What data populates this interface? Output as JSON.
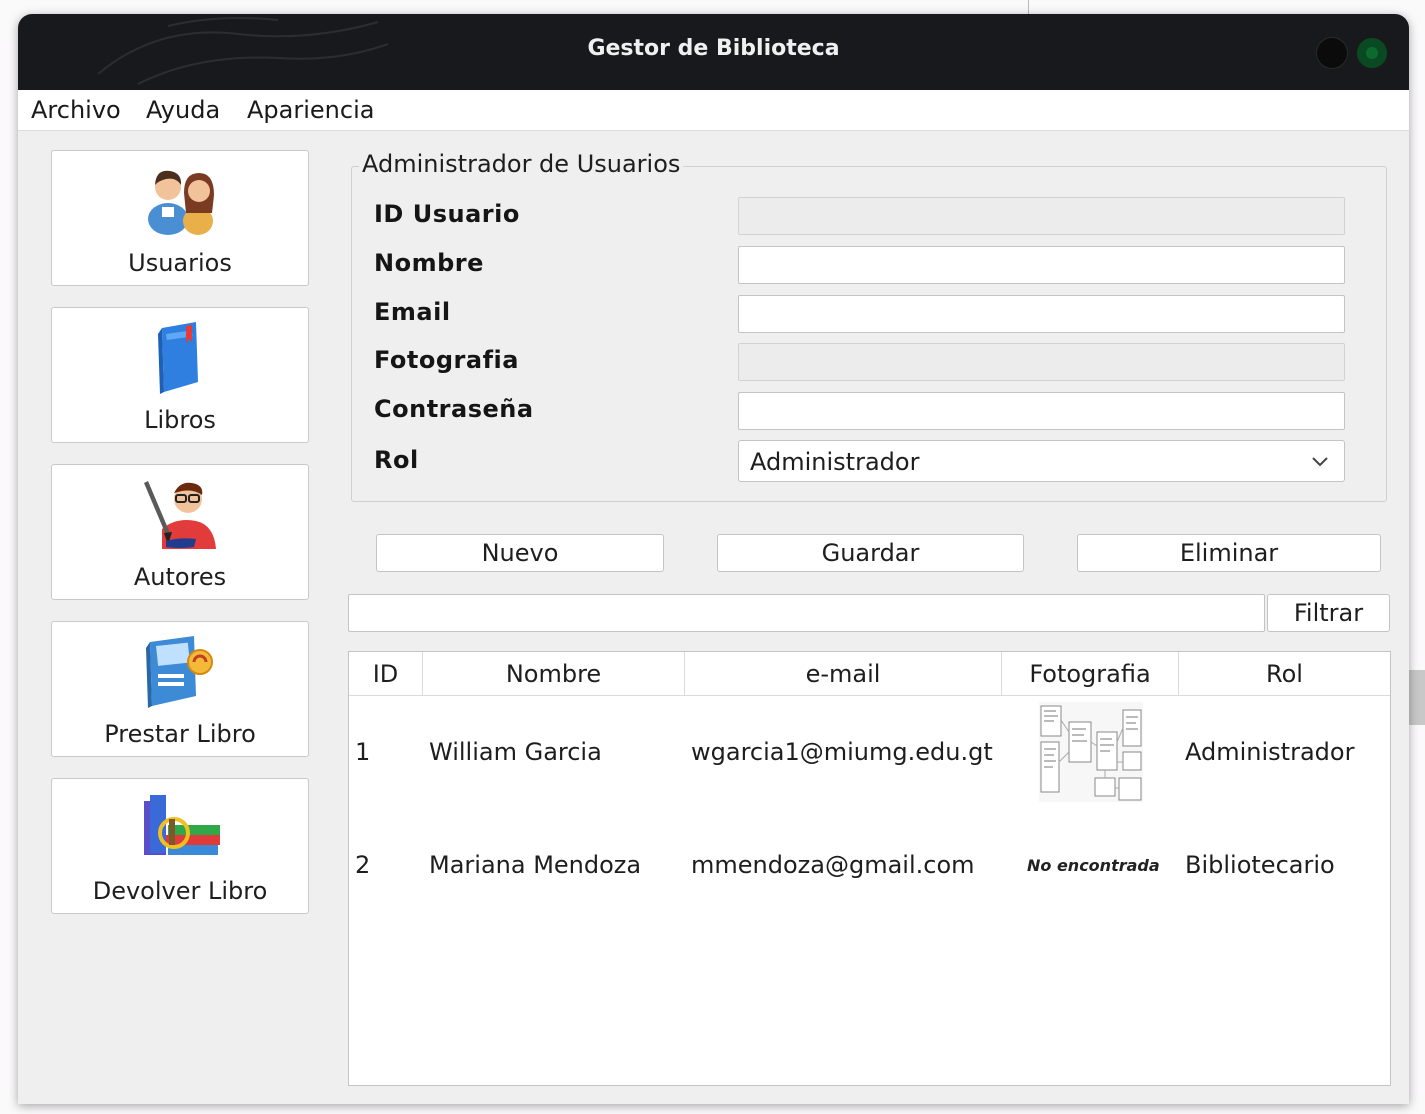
{
  "window": {
    "title": "Gestor de Biblioteca"
  },
  "menu": [
    "Archivo",
    "Ayuda",
    "Apariencia"
  ],
  "sidebar": {
    "items": [
      {
        "label": "Usuarios",
        "icon": "users-icon"
      },
      {
        "label": "Libros",
        "icon": "book-icon"
      },
      {
        "label": "Autores",
        "icon": "author-icon"
      },
      {
        "label": "Prestar Libro",
        "icon": "lend-book-icon"
      },
      {
        "label": "Devolver Libro",
        "icon": "return-book-icon"
      }
    ]
  },
  "form": {
    "group_title": "Administrador de Usuarios",
    "labels": {
      "id": "ID Usuario",
      "nombre": "Nombre",
      "email": "Email",
      "fotografia": "Fotografia",
      "contrasena": "Contraseña",
      "rol": "Rol"
    },
    "values": {
      "id": "",
      "nombre": "",
      "email": "",
      "fotografia": "",
      "contrasena": ""
    },
    "rol_selected": "Administrador"
  },
  "actions": {
    "nuevo": "Nuevo",
    "guardar": "Guardar",
    "eliminar": "Eliminar"
  },
  "filter": {
    "value": "",
    "button": "Filtrar"
  },
  "table": {
    "columns": [
      "ID",
      "Nombre",
      "e-mail",
      "Fotografia",
      "Rol"
    ],
    "rows": [
      {
        "id": "1",
        "nombre": "William Garcia",
        "email": "wgarcia1@miumg.edu.gt",
        "foto": "",
        "rol": "Administrador"
      },
      {
        "id": "2",
        "nombre": "Mariana Mendoza",
        "email": "mmendoza@gmail.com",
        "foto": "No encontrada",
        "rol": "Bibliotecario"
      }
    ]
  },
  "colors": {
    "titlebar": "#17191d",
    "window_bg": "#efefef",
    "close_button": "#0b0b0b",
    "maximize_button": "#0a4a22"
  }
}
